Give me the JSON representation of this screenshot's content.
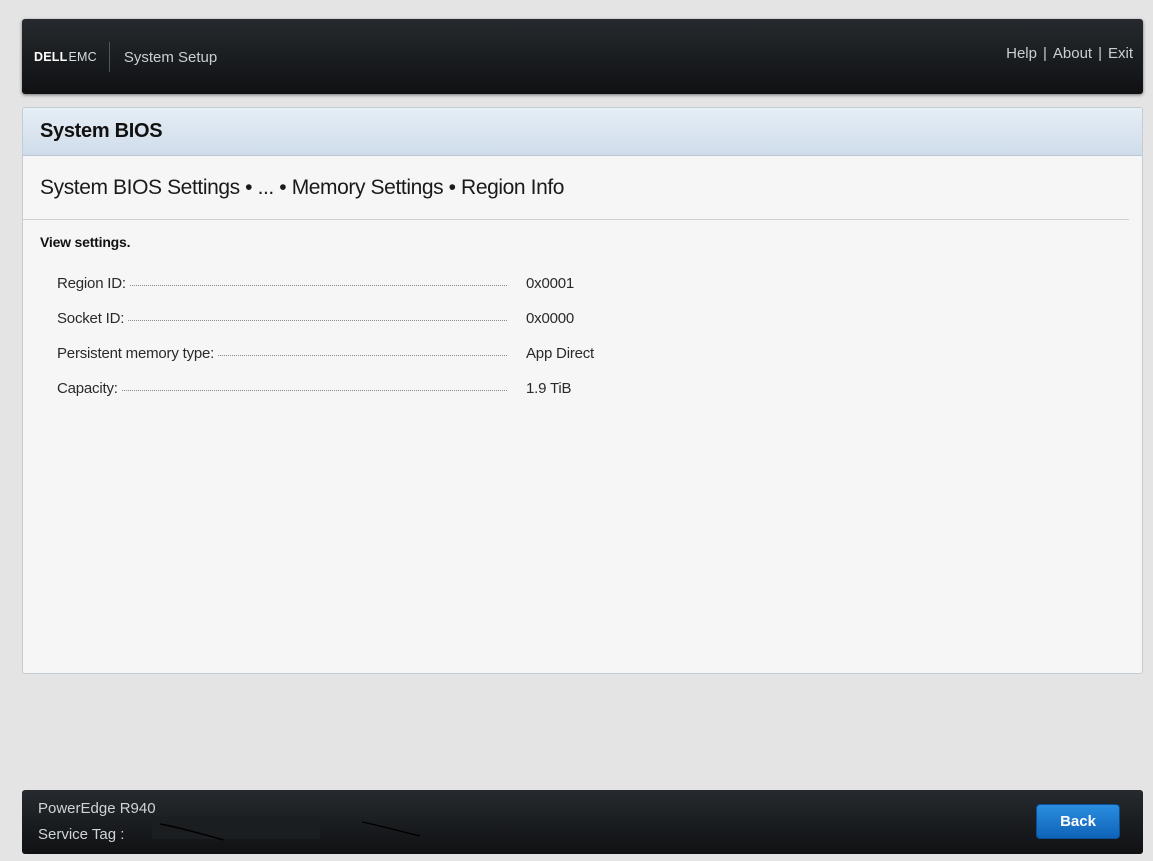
{
  "header": {
    "logo_brand": "DELL",
    "logo_suffix": "EMC",
    "app_title": "System Setup",
    "links": {
      "help": "Help",
      "about": "About",
      "exit": "Exit",
      "separator": "|"
    }
  },
  "panel": {
    "title": "System BIOS",
    "breadcrumb": "System BIOS Settings • ... • Memory Settings • Region Info",
    "subtitle": "View settings.",
    "rows": [
      {
        "label": "Region ID:",
        "value": "0x0001"
      },
      {
        "label": "Socket ID:",
        "value": "0x0000"
      },
      {
        "label": "Persistent memory type:",
        "value": "App Direct"
      },
      {
        "label": "Capacity:",
        "value": "1.9 TiB"
      }
    ]
  },
  "footer": {
    "model": "PowerEdge R940",
    "service_tag_label": "Service Tag :",
    "back_label": "Back"
  },
  "colors": {
    "header_bg": "#1a1d20",
    "panel_header_bg": "#d9e4ef",
    "back_button": "#1b78cc"
  }
}
